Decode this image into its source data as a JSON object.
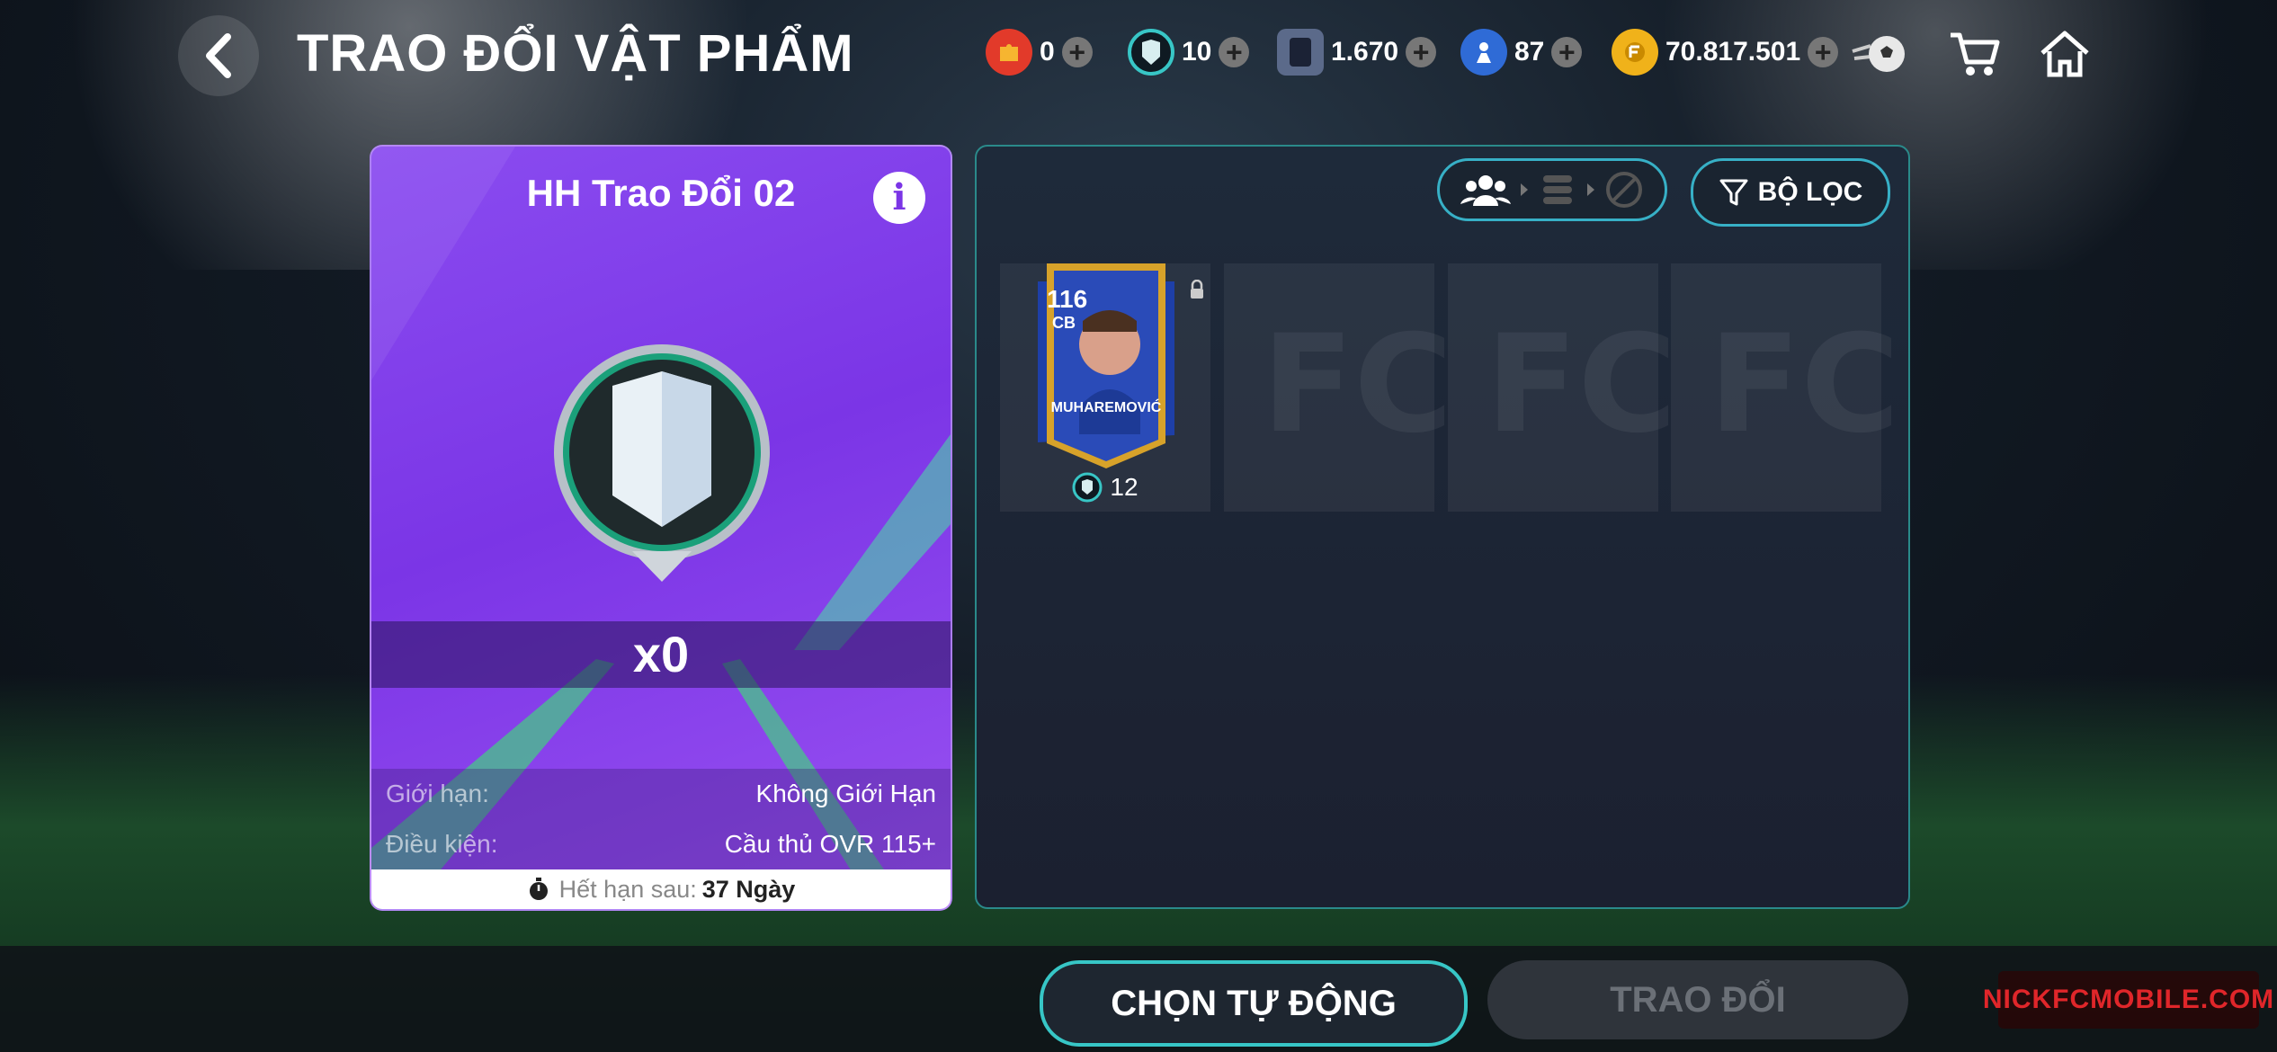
{
  "header": {
    "title": "TRAO ĐỔI VẬT PHẨM",
    "currencies": [
      {
        "icon": "puzzle-token-icon",
        "value": "0",
        "color": "#e23a2a"
      },
      {
        "icon": "exchange-shield-icon",
        "value": "10",
        "color": "#38c6c6"
      },
      {
        "icon": "card-token-icon",
        "value": "1.670",
        "color": "#5b6a8a"
      },
      {
        "icon": "player-token-icon",
        "value": "87",
        "color": "#2f6bd6"
      },
      {
        "icon": "fc-coin-icon",
        "value": "70.817.501",
        "color": "#f0b21a"
      }
    ]
  },
  "card": {
    "title": "HH Trao Đổi 02",
    "quantity": "x0",
    "limit_label": "Giới hạn:",
    "limit_value": "Không Giới Hạn",
    "condition_label": "Điều kiện:",
    "condition_value": "Cầu thủ OVR 115+",
    "expiry_label": "Hết hạn sau:",
    "expiry_value": "37 Ngày"
  },
  "panel": {
    "filter_label": "BỘ LỌC",
    "slots": [
      {
        "rating": "116",
        "position": "CB",
        "name": "MUHAREMOVIĆ",
        "count": "12",
        "locked": true
      }
    ]
  },
  "buttons": {
    "auto_select": "CHỌN TỰ ĐỘNG",
    "trade": "TRAO ĐỔI"
  },
  "watermark": "NICKFCMOBILE.COM",
  "colors": {
    "card_purple": "#7b35e6",
    "accent_teal": "#37c6c6",
    "gold": "#f0b21a"
  }
}
